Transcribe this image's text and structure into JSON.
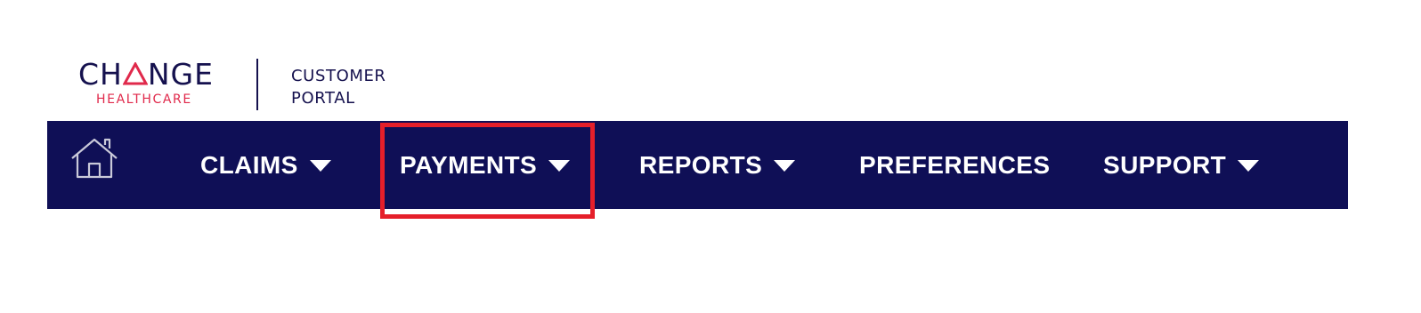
{
  "logo": {
    "brand_word_left": "CH",
    "brand_word_right": "NGE",
    "brand_sub": "HEALTHCARE",
    "portal_line1": "CUSTOMER",
    "portal_line2": "PORTAL",
    "brand_color": "#15114e",
    "accent_color": "#e0294b"
  },
  "nav": {
    "background": "#0f0f56",
    "home_icon": "home-icon",
    "items": [
      {
        "label": "CLAIMS",
        "has_dropdown": true
      },
      {
        "label": "PAYMENTS",
        "has_dropdown": true
      },
      {
        "label": "REPORTS",
        "has_dropdown": true
      },
      {
        "label": "PREFERENCES",
        "has_dropdown": false
      },
      {
        "label": "SUPPORT",
        "has_dropdown": true
      }
    ]
  },
  "highlight": {
    "target": "PAYMENTS",
    "color": "#e51f2a"
  }
}
